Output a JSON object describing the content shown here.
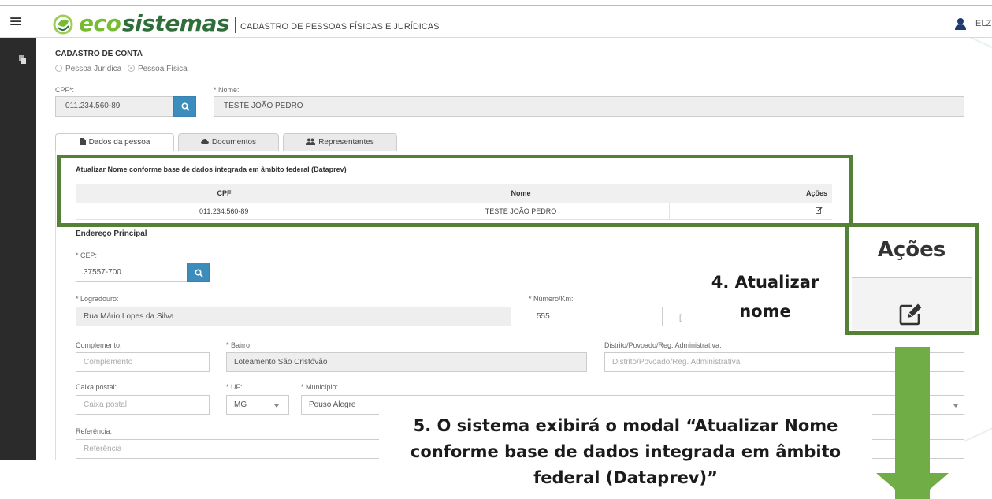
{
  "header": {
    "logo_eco": "eco",
    "logo_sistemas": "sistemas",
    "app_title": "CADASTRO DE PESSOAS FÍSICAS E JURÍDICAS",
    "user_name": "ELZ"
  },
  "form": {
    "section_title": "CADASTRO DE CONTA",
    "radio_juridica": "Pessoa Jurídica",
    "radio_fisica": "Pessoa Física",
    "cpf_label": "CPF*:",
    "cpf_value": "011.234.560-89",
    "nome_label": "* Nome:",
    "nome_value": "TESTE JOÃO PEDRO"
  },
  "tabs": [
    {
      "label": "Dados da pessoa",
      "icon": "file-icon"
    },
    {
      "label": "Documentos",
      "icon": "cloud-icon"
    },
    {
      "label": "Representantes",
      "icon": "users-icon"
    }
  ],
  "dataprev": {
    "title": "Atualizar Nome conforme base de dados integrada em âmbito federal (Dataprev)",
    "headers": [
      "CPF",
      "Nome",
      "Ações"
    ],
    "row": {
      "cpf": "011.234.560-89",
      "nome": "TESTE JOÃO PEDRO"
    }
  },
  "address": {
    "title": "Endereço Principal",
    "cep_label": "* CEP:",
    "cep_value": "37557-700",
    "logradouro_label": "* Logradouro:",
    "logradouro_value": "Rua Mário Lopes da Silva",
    "numero_label": "* Número/Km:",
    "numero_value": "555",
    "small_mark": "[",
    "complemento_label": "Complemento:",
    "complemento_placeholder": "Complemento",
    "bairro_label": "* Bairro:",
    "bairro_value": "Loteamento São Cristóvão",
    "distrito_label": "Distrito/Povoado/Reg. Administrativa:",
    "distrito_placeholder": "Distrito/Povoado/Reg. Administrativa",
    "caixa_label": "Caixa postal:",
    "caixa_placeholder": "Caixa postal",
    "uf_label": "* UF:",
    "uf_value": "MG",
    "municipio_label": "* Município:",
    "municipio_value": "Pouso Alegre",
    "referencia_label": "Referência:",
    "referencia_placeholder": "Referência"
  },
  "annotations": {
    "zoom_title": "Ações",
    "step4": "4. Atualizar nome",
    "step5": "5. O sistema exibirá o modal “Atualizar Nome conforme base de dados integrada em âmbito federal (Dataprev)”",
    "green_dark": "#538135",
    "green_light": "#70ad47"
  }
}
